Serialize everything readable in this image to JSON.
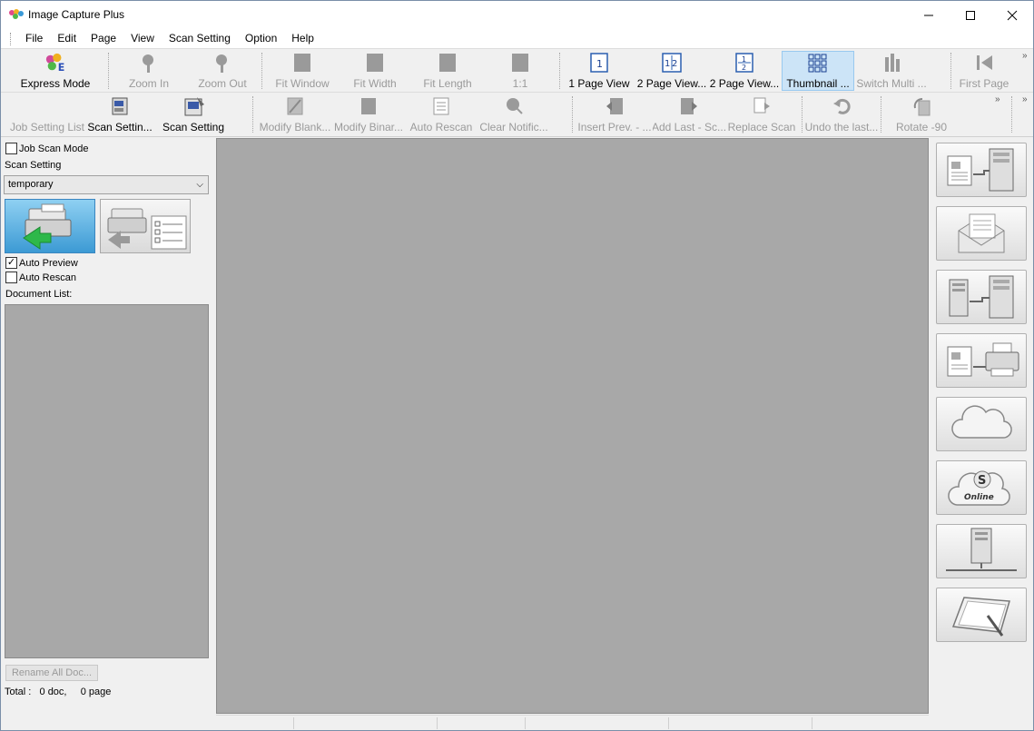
{
  "window": {
    "title": "Image Capture Plus"
  },
  "menu": [
    "File",
    "Edit",
    "Page",
    "View",
    "Scan Setting",
    "Option",
    "Help"
  ],
  "toolbar1": {
    "express_mode": "Express Mode",
    "zoom_in": "Zoom In",
    "zoom_out": "Zoom Out",
    "fit_window": "Fit Window",
    "fit_width": "Fit Width",
    "fit_length": "Fit Length",
    "one_to_one": "1:1",
    "one_page_view": "1 Page View",
    "two_page_view_a": "2 Page View...",
    "two_page_view_b": "2 Page View...",
    "thumbnail": "Thumbnail ...",
    "switch_multi": "Switch Multi ...",
    "first_page": "First Page"
  },
  "toolbar2": {
    "job_setting_list": "Job Setting List",
    "scan_setting_short": "Scan Settin...",
    "scan_setting": "Scan Setting",
    "modify_blank": "Modify Blank...",
    "modify_binar": "Modify Binar...",
    "auto_rescan": "Auto Rescan",
    "clear_notific": "Clear Notific...",
    "insert_prev": "Insert Prev. - ...",
    "add_last": "Add Last - Sc...",
    "replace_scan": "Replace Scan",
    "undo_last": "Undo the last...",
    "rotate": "Rotate -90"
  },
  "left": {
    "job_scan_mode": "Job Scan Mode",
    "scan_setting_label": "Scan Setting",
    "scan_setting_value": "temporary",
    "auto_preview": "Auto Preview",
    "auto_preview_checked": true,
    "auto_rescan": "Auto Rescan",
    "auto_rescan_checked": false,
    "document_list": "Document List:",
    "rename_all": "Rename All Doc...",
    "total": "Total :   0 doc,     0 page"
  },
  "right_icons": [
    "document-to-server-icon",
    "email-icon",
    "server-to-server-icon",
    "print-icon",
    "cloud-icon",
    "sharepoint-online-icon",
    "network-server-icon",
    "tablet-pen-icon"
  ],
  "colors": {
    "canvas": "#a8a8a8",
    "selected": "#cce4f7",
    "scan_button": "#5aaedc"
  }
}
